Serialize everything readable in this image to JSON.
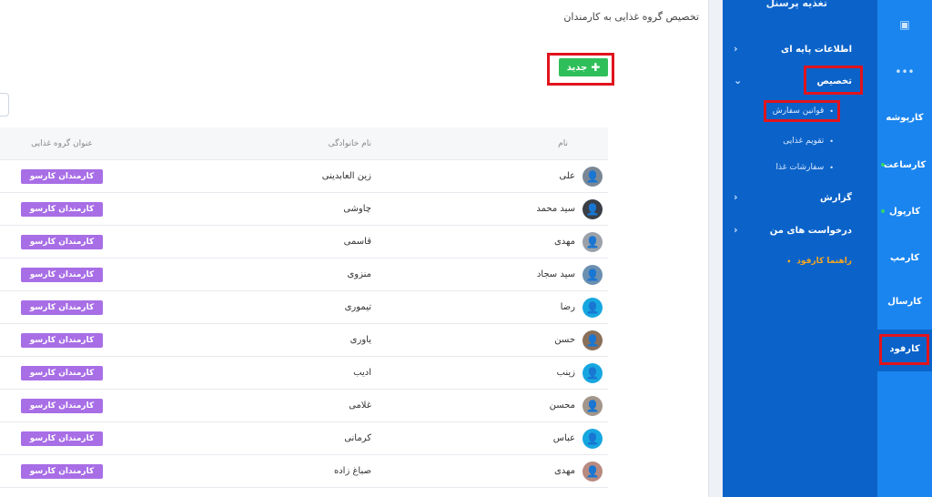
{
  "main": {
    "page_title": "تخصیص گروه غذایی به کارمندان",
    "new_button_label": "جدید",
    "table": {
      "headers": {
        "name": "نام",
        "family": "نام خانوادگی",
        "group": "عنوان گروه غذایی"
      },
      "rows": [
        {
          "name": "علی",
          "family": "زین العابدینی",
          "group": "کارمندان کارسو"
        },
        {
          "name": "سید محمد",
          "family": "چاوشی",
          "group": "کارمندان کارسو"
        },
        {
          "name": "مهدی",
          "family": "قاسمی",
          "group": "کارمندان کارسو"
        },
        {
          "name": "سید سجاد",
          "family": "منزوی",
          "group": "کارمندان کارسو"
        },
        {
          "name": "رضا",
          "family": "تیموری",
          "group": "کارمندان کارسو"
        },
        {
          "name": "حسن",
          "family": "یاوری",
          "group": "کارمندان کارسو"
        },
        {
          "name": "زینب",
          "family": "ادیب",
          "group": "کارمندان کارسو"
        },
        {
          "name": "محسن",
          "family": "غلامی",
          "group": "کارمندان کارسو"
        },
        {
          "name": "عباس",
          "family": "کرمانی",
          "group": "کارمندان کارسو"
        },
        {
          "name": "مهدی",
          "family": "صباغ زاده",
          "group": "کارمندان کارسو"
        }
      ]
    }
  },
  "sidebar": {
    "title": "تغذیه پرسنل",
    "items": [
      {
        "label": "اطلاعات پایه ای"
      },
      {
        "label": "تخصیص"
      },
      {
        "label": "گزارش"
      },
      {
        "label": "درخواست های من"
      }
    ],
    "sub_items": [
      {
        "label": "قوانین سفارش"
      },
      {
        "label": "تقویم غذایی"
      },
      {
        "label": "سفارشات غذا"
      }
    ],
    "guide": "راهنما کارفود"
  },
  "rail": {
    "items": [
      {
        "label": "کارپوشه"
      },
      {
        "label": "کارساعت"
      },
      {
        "label": "کارپول"
      },
      {
        "label": "کارمپ"
      },
      {
        "label": "کارسال"
      },
      {
        "label": "کارفود"
      }
    ]
  },
  "colors": {
    "sidebar_bg": "#0b63c9",
    "rail_bg": "#1a85ef",
    "new_button": "#2fbf5a",
    "badge": "#a86ee6",
    "highlight": "#e0141d",
    "guide": "#f5a623"
  }
}
